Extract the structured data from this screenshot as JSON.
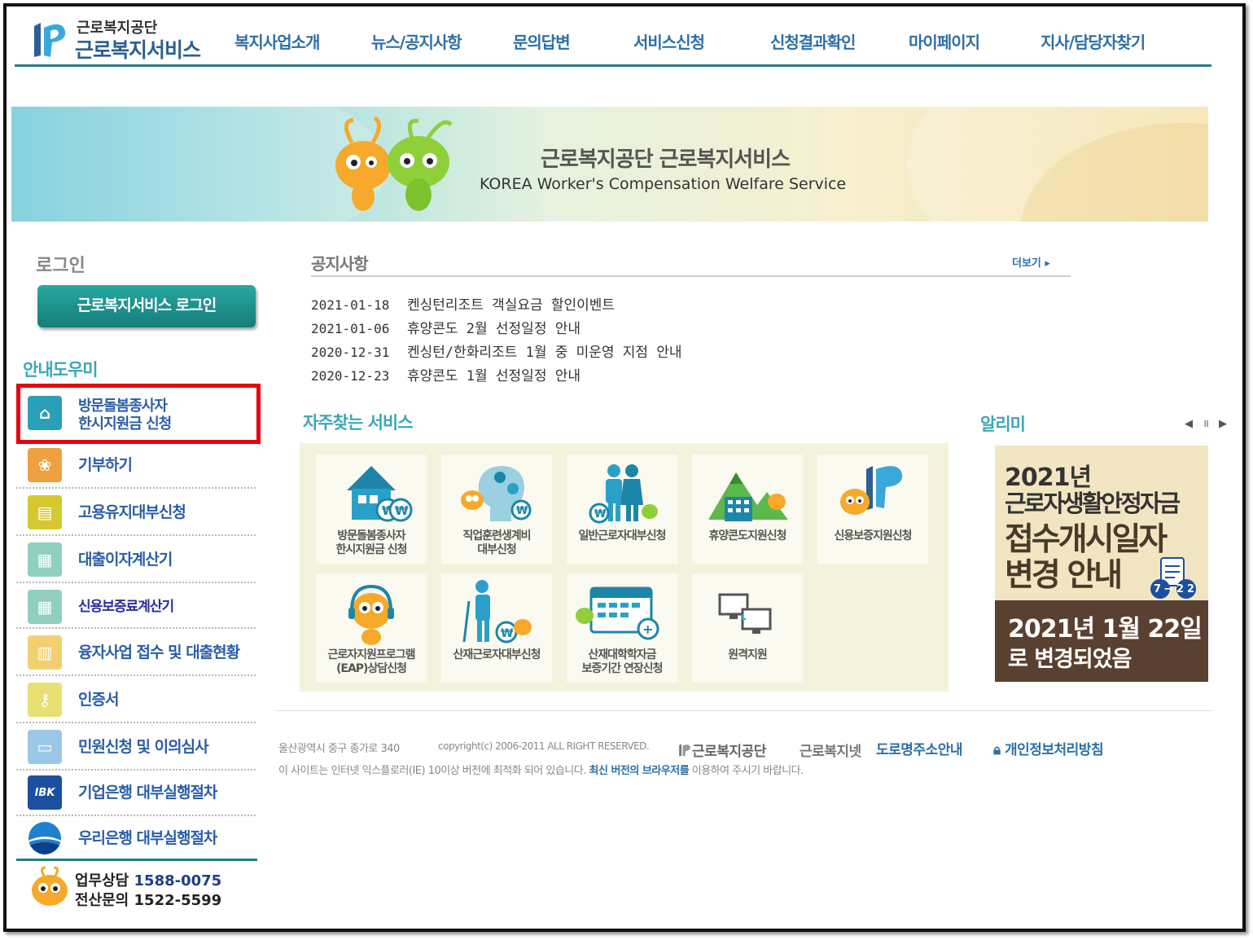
{
  "header": {
    "logo_sub": "근로복지공단",
    "logo_main": "근로복지서비스",
    "nav": [
      "복지사업소개",
      "뉴스/공지사항",
      "문의답변",
      "서비스신청",
      "신청결과확인",
      "마이페이지",
      "지사/담당자찾기"
    ]
  },
  "banner": {
    "title": "근로복지공단 근로복지서비스",
    "subtitle": "KOREA Worker's Compensation Welfare Service"
  },
  "login": {
    "title": "로그인",
    "button": "근로복지서비스 로그인"
  },
  "guide": {
    "title": "안내도우미",
    "items": [
      {
        "label_1": "방문돌봄종사자",
        "label_2": "한시지원금 신청",
        "icon": "house-icon",
        "color": "#2aa0b8"
      },
      {
        "label_1": "기부하기",
        "label_2": "",
        "icon": "gift-icon",
        "color": "#f0a040"
      },
      {
        "label_1": "고용유지대부신청",
        "label_2": "",
        "icon": "id-card-icon",
        "color": "#d6c830"
      },
      {
        "label_1": "대출이자계산기",
        "label_2": "",
        "icon": "calculator-icon",
        "color": "#8fcfc0"
      },
      {
        "label_1": "신용보증료계산기",
        "label_2": "",
        "icon": "calculator-icon",
        "color": "#8fcfc0"
      },
      {
        "label_1": "융자사업 접수 및 대출현황",
        "label_2": "",
        "icon": "chart-icon",
        "color": "#f2d070"
      },
      {
        "label_1": "인증서",
        "label_2": "",
        "icon": "key-icon",
        "color": "#e8e070"
      },
      {
        "label_1": "민원신청 및 이의심사",
        "label_2": "",
        "icon": "document-icon",
        "color": "#9cc8e8"
      },
      {
        "label_1": "기업은행 대부실행절차",
        "label_2": "",
        "icon": "ibk-logo-icon",
        "color": "#1d4fa0"
      },
      {
        "label_1": "우리은행 대부실행절차",
        "label_2": "",
        "icon": "woori-logo-icon",
        "color": "#1f7fd0"
      }
    ],
    "highlight_color": "#e8000f"
  },
  "contact": {
    "line1_label": "업무상담",
    "line1_number": "1588-0075",
    "line2_label": "전산문의",
    "line2_number": "1522-5599"
  },
  "notice": {
    "title": "공지사항",
    "more": "더보기",
    "rows": [
      {
        "date": "2021-01-18",
        "text": "켄싱턴리조트 객실요금 할인이벤트"
      },
      {
        "date": "2021-01-06",
        "text": "휴양콘도 2월 선정일정 안내"
      },
      {
        "date": "2020-12-31",
        "text": "켄싱턴/한화리조트 1월 중 미운영 지점 안내"
      },
      {
        "date": "2020-12-23",
        "text": "휴양콘도 1월 선정일정 안내"
      }
    ]
  },
  "services": {
    "title": "자주찾는 서비스",
    "items": [
      {
        "label_1": "방문돌봄종사자",
        "label_2": "한시지원금 신청",
        "icon": "house-coin-icon"
      },
      {
        "label_1": "직업훈련생계비",
        "label_2": "대부신청",
        "icon": "head-gear-icon"
      },
      {
        "label_1": "일반근로자대부신청",
        "label_2": "",
        "icon": "couple-icon"
      },
      {
        "label_1": "휴양콘도지원신청",
        "label_2": "",
        "icon": "resort-icon"
      },
      {
        "label_1": "신용보증지원신청",
        "label_2": "",
        "icon": "mascot-logo-icon"
      },
      {
        "label_1": "근로자지원프로그램",
        "label_2": "(EAP)상담신청",
        "icon": "mascot-headset-icon"
      },
      {
        "label_1": "산재근로자대부신청",
        "label_2": "",
        "icon": "crutch-person-icon"
      },
      {
        "label_1": "산재대학학자금",
        "label_2": "보증기간 연장신청",
        "icon": "calendar-icon"
      },
      {
        "label_1": "원격지원",
        "label_2": "",
        "icon": "monitors-icon"
      }
    ]
  },
  "alrimi": {
    "title": "알리미",
    "controls": "◀ ॥ ▶",
    "line1": "2021년",
    "line2": "근로자생활안정자금",
    "line3": "접수개시일자",
    "line4": "변경 안내",
    "badge": "7→22",
    "line5": "2021년 1월 22일",
    "line6": "로 변경되었음"
  },
  "footer": {
    "address": "울산광역시 중구 종가로 340",
    "copyright": "copyright(c) 2006-2011 ALL RIGHT RESERVED.",
    "org": "근로복지공단",
    "link1": "근로복지넷",
    "link2": "도로명주소안내",
    "link3": "개인정보처리방침",
    "notice_a": "이 사이트는 인터넷 익스플로러(IE) 10이상 버전에 최적화 되어 있습니다.",
    "notice_link": "최신 버전의 브라우저를",
    "notice_b": "이용하여 주시기 바랍니다."
  }
}
